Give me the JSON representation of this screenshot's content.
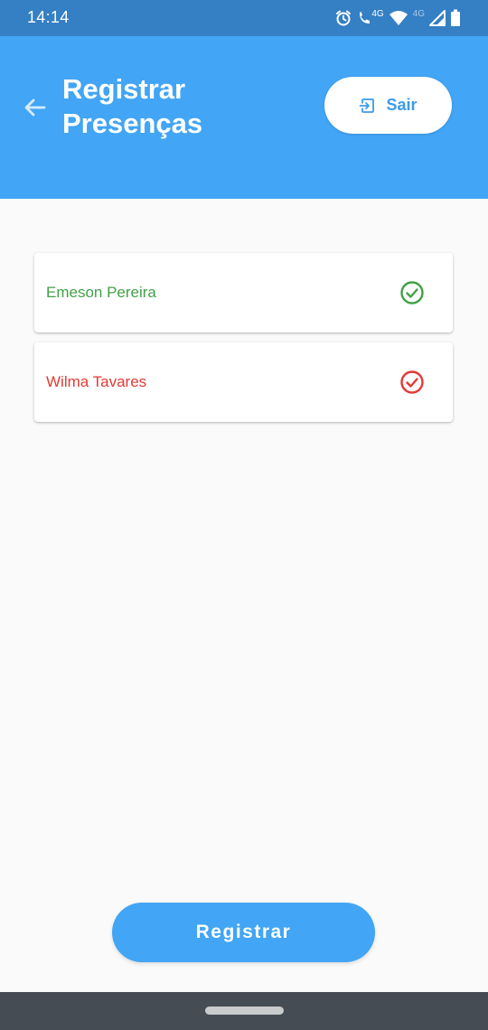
{
  "status_bar": {
    "time": "14:14",
    "icons": [
      "alarm-icon",
      "volte-call-icon",
      "wifi-icon",
      "cell-signal-icon",
      "battery-icon"
    ],
    "volte_label": "4G",
    "network_label": "4G"
  },
  "app_bar": {
    "title": "Registrar\nPresenças",
    "back_icon": "arrow-left-icon",
    "logout_button": {
      "label": "Sair",
      "icon": "exit-to-app-icon"
    }
  },
  "attendance": {
    "students": [
      {
        "name": "Emeson Pereira",
        "status": "present",
        "icon": "check-circle-icon",
        "color": "#43A047"
      },
      {
        "name": "Wilma Tavares",
        "status": "absent",
        "icon": "check-circle-icon",
        "color": "#E53935"
      }
    ]
  },
  "register_button": {
    "label": "Registrar"
  },
  "colors": {
    "app_bar": "#42A5F5",
    "status_bar": "#357FC4",
    "background": "#FAFAFA",
    "present": "#43A047",
    "absent": "#E53935",
    "nav_bar": "#464C54"
  }
}
